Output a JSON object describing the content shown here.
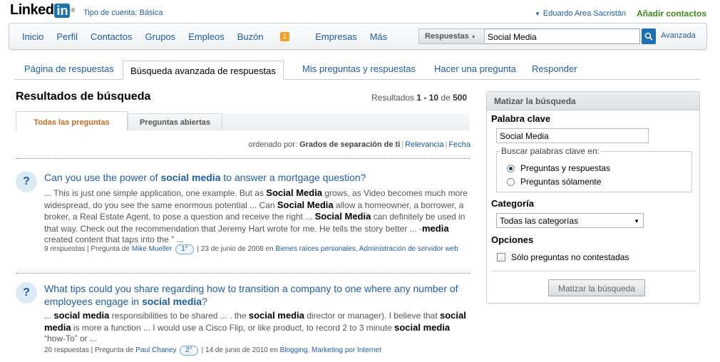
{
  "header": {
    "logo_text": "Linked",
    "logo_in": "in",
    "logo_reg": "®",
    "account_type": "Tipo de cuenta: Básica",
    "user_name": "Eduardo Area Sacristán",
    "add_contacts": "Añadir contactos"
  },
  "nav": {
    "items": [
      "Inicio",
      "Perfil",
      "Contactos",
      "Grupos",
      "Empleos",
      "Buzón",
      "Empresas",
      "Más"
    ],
    "inbox_badge": "1",
    "search_scope": "Respuestas",
    "search_value": "Social Media",
    "advanced": "Avanzada"
  },
  "tabs": [
    "Página de respuestas",
    "Búsqueda avanzada de respuestas",
    "Mis preguntas y respuestas",
    "Hacer una pregunta",
    "Responder"
  ],
  "results": {
    "title": "Resultados de búsqueda",
    "count_prefix": "Resultados ",
    "count_range": "1 - 10",
    "count_of": " de ",
    "count_total": "500",
    "subtabs": [
      "Todas las preguntas",
      "Preguntas abiertas"
    ],
    "sort_prefix": "ordenado por: ",
    "sort_options": [
      "Grados de separación de ti",
      "Relevancia",
      "Fecha"
    ]
  },
  "questions": [
    {
      "title_pre": "Can you use the power of ",
      "title_bold": "social media",
      "title_post": " to answer a mortgage question?",
      "snippet_1": "... This is just one simple application, one example. But as ",
      "snippet_b1": "Social Media",
      "snippet_2": " grows, as Video becomes much more widespread, do you see the same enormous potential ... Can ",
      "snippet_b2": "Social Media",
      "snippet_3": " allow a homeowner, a borrower, a broker, a Real Estate Agent, to pose a question and receive the right ... ",
      "snippet_b3": "Social Media",
      "snippet_4": " can definitely be used in that way. Check out the recommendation that Jeremy Hart wrote for me. He tells the story better ... -",
      "snippet_b4": "media",
      "snippet_5": " created content that taps into the \" ...",
      "answers": "9 respuestas",
      "asked_by_prefix": "Pregunta de ",
      "author": "Mike Mueller",
      "degree": "1°",
      "date": "23 de junio de 2008 en ",
      "category_1": "Bienes raíces personales",
      "category_2": "Administración de servidor web"
    },
    {
      "title_pre": "What tips could you share regarding how to transition a company to one where any number of employees engage in ",
      "title_bold": "social media",
      "title_post": "?",
      "snippet_1": "... ",
      "snippet_b1": "social media",
      "snippet_2": " responsibilities to be shared ... . the ",
      "snippet_b2": "social media",
      "snippet_3": " director or manager). I believe that ",
      "snippet_b3": "social media",
      "snippet_4": " is more a function ... I would use a Cisco Flip, or like product, to record 2 to 3 minute ",
      "snippet_b4": "social media",
      "snippet_5": " “how-To” or ...",
      "answers": "20 respuestas",
      "asked_by_prefix": "Pregunta de ",
      "author": "Paul Chaney",
      "degree": "2°",
      "date": "14 de junio de 2010 en ",
      "category_1": "Blogging",
      "category_2": "Marketing por Internet"
    }
  ],
  "refine": {
    "title": "Matizar la búsqueda",
    "keyword_label": "Palabra clave",
    "keyword_value": "Social Media",
    "search_in_legend": "Buscar palabras clave en:",
    "radio_1": "Preguntas y respuestas",
    "radio_2": "Preguntas sólamente",
    "category_label": "Categoría",
    "category_value": "Todas las categorías",
    "options_label": "Opciones",
    "checkbox_label": "Sólo preguntas no contestadas",
    "button": "Matizar la búsqueda"
  },
  "colors": {
    "link": "#1f5c9f",
    "add_contacts": "#3b8b19",
    "active_subtab": "#c46b1b",
    "badge": "#f3a12d",
    "logo_blue": "#1c73ad"
  }
}
